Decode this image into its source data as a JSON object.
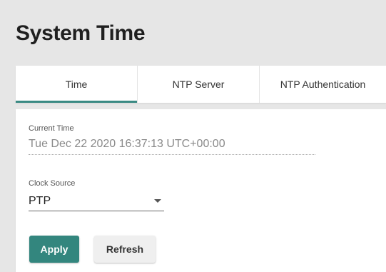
{
  "page": {
    "title": "System Time"
  },
  "tabs": [
    {
      "label": "Time",
      "active": true
    },
    {
      "label": "NTP Server",
      "active": false
    },
    {
      "label": "NTP Authentication",
      "active": false
    }
  ],
  "form": {
    "current_time": {
      "label": "Current Time",
      "value": "Tue Dec 22 2020 16:37:13 UTC+00:00"
    },
    "clock_source": {
      "label": "Clock Source",
      "value": "PTP"
    }
  },
  "buttons": {
    "apply": "Apply",
    "refresh": "Refresh"
  },
  "colors": {
    "accent": "#33867e",
    "tab_indicator": "#3a8a83",
    "background": "#e6e6e6"
  },
  "icons": {
    "clock_source_dropdown": "caret-down-icon"
  }
}
